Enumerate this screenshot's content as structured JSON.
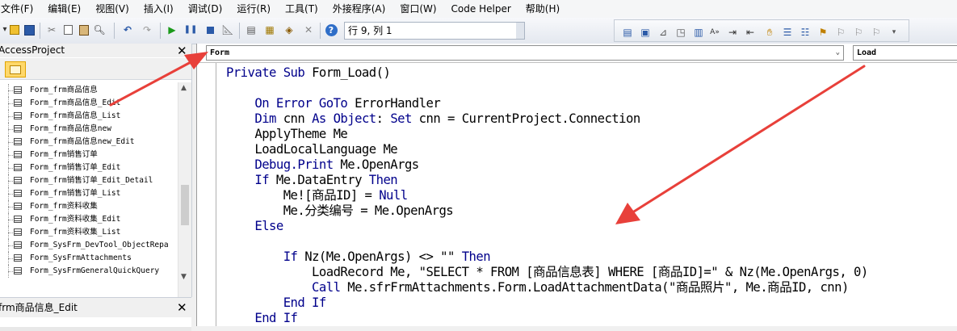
{
  "menu": [
    {
      "label": "文件(F)"
    },
    {
      "label": "编辑(E)"
    },
    {
      "label": "视图(V)"
    },
    {
      "label": "插入(I)"
    },
    {
      "label": "调试(D)"
    },
    {
      "label": "运行(R)"
    },
    {
      "label": "工具(T)"
    },
    {
      "label": "外接程序(A)"
    },
    {
      "label": "窗口(W)"
    },
    {
      "label": "Code Helper"
    },
    {
      "label": "帮助(H)"
    }
  ],
  "toolbar": {
    "position_text": "行 9, 列 1"
  },
  "project": {
    "title": "AccessProject",
    "items": [
      "Form_frm商品信息",
      "Form_frm商品信息_Edit",
      "Form_frm商品信息_List",
      "Form_frm商品信息new",
      "Form_frm商品信息new_Edit",
      "Form_frm销售订单",
      "Form_frm销售订单_Edit",
      "Form_frm销售订单_Edit_Detail",
      "Form_frm销售订单_List",
      "Form_frm资料收集",
      "Form_frm资料收集_Edit",
      "Form_frm资料收集_List",
      "Form_SysFrm_DevTool_ObjectRepa",
      "Form_SysFrmAttachments",
      "Form_SysFrmGeneralQuickQuery"
    ]
  },
  "properties": {
    "title": "frm商品信息_Edit"
  },
  "code_window": {
    "object_combo": "Form",
    "procedure_combo": "Load",
    "lines": [
      [
        {
          "t": "Private Sub ",
          "k": 1
        },
        {
          "t": "Form_Load()",
          "k": 0
        }
      ],
      [],
      [
        {
          "t": "    On Error GoTo ",
          "k": 1
        },
        {
          "t": "ErrorHandler",
          "k": 0
        }
      ],
      [
        {
          "t": "    Dim ",
          "k": 1
        },
        {
          "t": "cnn ",
          "k": 0
        },
        {
          "t": "As Object",
          "k": 1
        },
        {
          "t": ": ",
          "k": 0
        },
        {
          "t": "Set ",
          "k": 1
        },
        {
          "t": "cnn = CurrentProject.Connection",
          "k": 0
        }
      ],
      [
        {
          "t": "    ApplyTheme Me",
          "k": 0
        }
      ],
      [
        {
          "t": "    LoadLocalLanguage Me",
          "k": 0
        }
      ],
      [
        {
          "t": "    Debug.Print ",
          "k": 1
        },
        {
          "t": "Me.OpenArgs",
          "k": 0
        }
      ],
      [
        {
          "t": "    If ",
          "k": 1
        },
        {
          "t": "Me.DataEntry ",
          "k": 0
        },
        {
          "t": "Then",
          "k": 1
        }
      ],
      [
        {
          "t": "        Me![商品ID] = ",
          "k": 0
        },
        {
          "t": "Null",
          "k": 1
        }
      ],
      [
        {
          "t": "        Me.分类编号 = Me.OpenArgs",
          "k": 0
        }
      ],
      [
        {
          "t": "    Else",
          "k": 1
        }
      ],
      [],
      [
        {
          "t": "        If ",
          "k": 1
        },
        {
          "t": "Nz(Me.OpenArgs) <> \"\" ",
          "k": 0
        },
        {
          "t": "Then",
          "k": 1
        }
      ],
      [
        {
          "t": "            LoadRecord Me, \"SELECT * FROM [商品信息表] WHERE [商品ID]=\" & Nz(Me.OpenArgs, 0)",
          "k": 0
        }
      ],
      [
        {
          "t": "            Call ",
          "k": 1
        },
        {
          "t": "Me.sfrFrmAttachments.Form.LoadAttachmentData(\"商品照片\", Me.商品ID, cnn)",
          "k": 0
        }
      ],
      [
        {
          "t": "        End If",
          "k": 1
        }
      ],
      [
        {
          "t": "    End If",
          "k": 1
        }
      ]
    ]
  },
  "colors": {
    "keyword": "#00008b",
    "arrow": "#e8403a",
    "folder": "#ffd86b"
  },
  "icons": [
    "dropdown-icon",
    "save-icon",
    "cut-icon",
    "copy-icon",
    "paste-icon",
    "find-icon",
    "undo-icon",
    "redo-icon",
    "run-icon",
    "break-icon",
    "reset-icon",
    "design-mode-icon",
    "project-explorer-icon",
    "properties-icon",
    "object-browser-icon",
    "toolbox-icon",
    "help-icon",
    "folder-icon",
    "close-icon",
    "form-icon"
  ]
}
